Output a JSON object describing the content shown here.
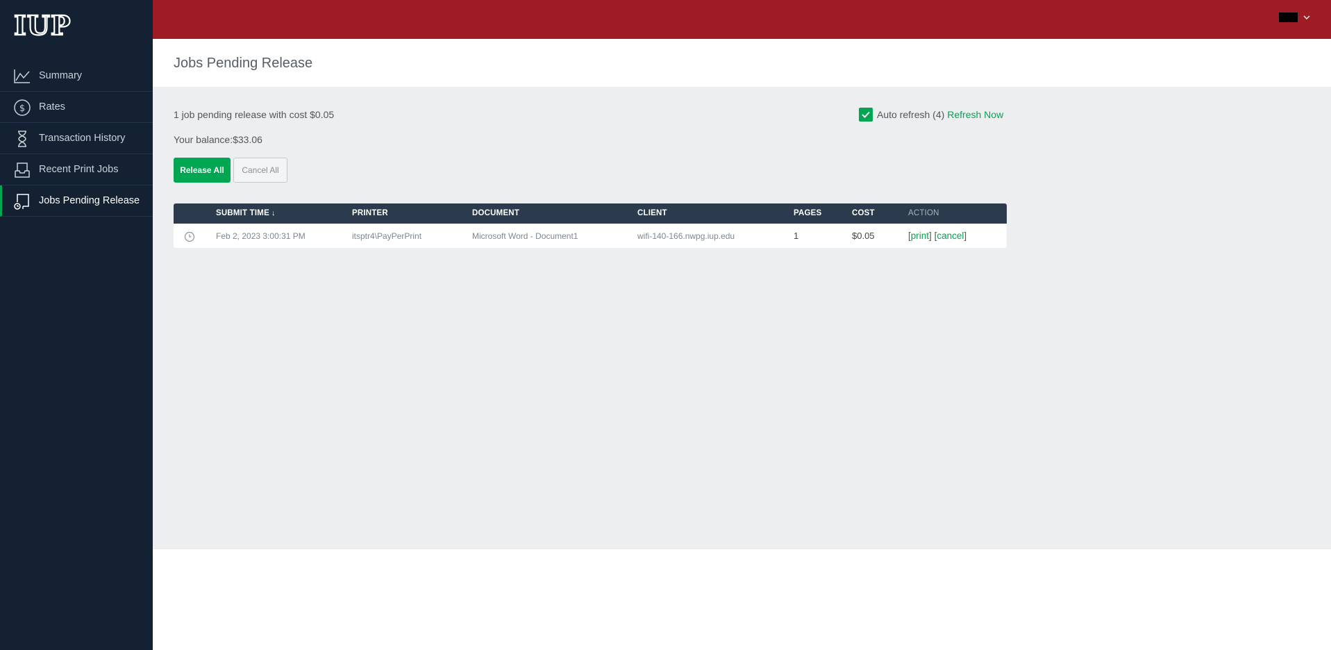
{
  "logo": {
    "text": "IUP"
  },
  "sidebar": {
    "items": [
      {
        "label": "Summary",
        "icon": "line-chart-icon",
        "active": false
      },
      {
        "label": "Rates",
        "icon": "dollar-circle-icon",
        "active": false
      },
      {
        "label": "Transaction History",
        "icon": "hourglass-icon",
        "active": false
      },
      {
        "label": "Recent Print Jobs",
        "icon": "printer-tray-icon",
        "active": false
      },
      {
        "label": "Jobs Pending Release",
        "icon": "print-release-icon",
        "active": true
      }
    ]
  },
  "header": {
    "title": "Jobs Pending Release"
  },
  "summary": {
    "count": "1",
    "pending_text": " job pending release with cost ",
    "cost": "$0.05",
    "balance_label": "Your balance:",
    "balance": "$33.06"
  },
  "refresh": {
    "label": "Auto refresh (4)",
    "link": "Refresh Now",
    "checked": true
  },
  "buttons": {
    "release_all": "Release All",
    "cancel_all": "Cancel All"
  },
  "table": {
    "columns": [
      "SUBMIT TIME",
      "PRINTER",
      "DOCUMENT",
      "CLIENT",
      "PAGES",
      "COST",
      "ACTION"
    ],
    "rows": [
      {
        "submit_time": "Feb 2, 2023 3:00:31 PM",
        "printer": "itsptr4\\PayPerPrint",
        "document": "Microsoft Word - Document1",
        "client": "wifi-140-166.nwpg.iup.edu",
        "pages": "1",
        "cost": "$0.05",
        "action_print": "print",
        "action_cancel": "cancel"
      }
    ]
  },
  "colors": {
    "topbar": "#a01c24",
    "sidebar": "#132133",
    "accent": "#00a651",
    "table_header": "#2b3a4c"
  }
}
